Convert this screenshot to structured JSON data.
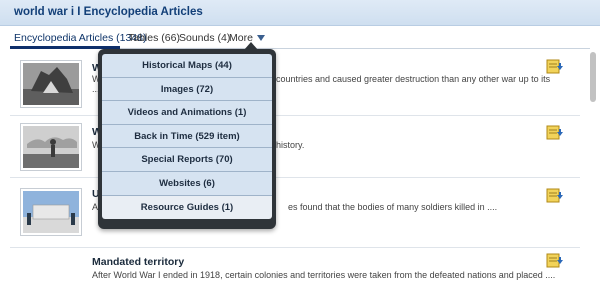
{
  "header": {
    "title": "world war i I Encyclopedia Articles"
  },
  "tabs": [
    {
      "label": "Encyclopedia Articles (1348)"
    },
    {
      "label": "Tables (66)"
    },
    {
      "label": "Sounds (4)"
    },
    {
      "label": "More"
    }
  ],
  "dropdown": {
    "items": [
      {
        "label": "Historical Maps (44)"
      },
      {
        "label": "Images (72)"
      },
      {
        "label": "Videos and Animations (1)"
      },
      {
        "label": "Back in Time (529 item)"
      },
      {
        "label": "Special Reports (70)"
      },
      {
        "label": "Websites (6)"
      },
      {
        "label": "Resource Guides (1)"
      }
    ]
  },
  "results": [
    {
      "title": "W",
      "desc": "W",
      "desc_visible": "countries and caused greater destruction than any other war up to its",
      "desc2": "..."
    },
    {
      "title": "W",
      "desc": "W",
      "desc_visible": "history."
    },
    {
      "title": "U",
      "desc": "Aft",
      "desc_visible": "es found that the bodies of many soldiers killed in ...."
    },
    {
      "title": "Mandated territory",
      "desc": "After World War I ended in 1918, certain colonies and territories were taken from the defeated nations and placed ...."
    }
  ],
  "icons": {
    "save": "save-to-folder-icon",
    "more_caret": "caret-down-icon"
  },
  "colors": {
    "header_bg": "#d6e4f3",
    "title": "#123f78",
    "dropdown_bg": "#2f3439",
    "dropdown_item": "#d6e3f1"
  }
}
